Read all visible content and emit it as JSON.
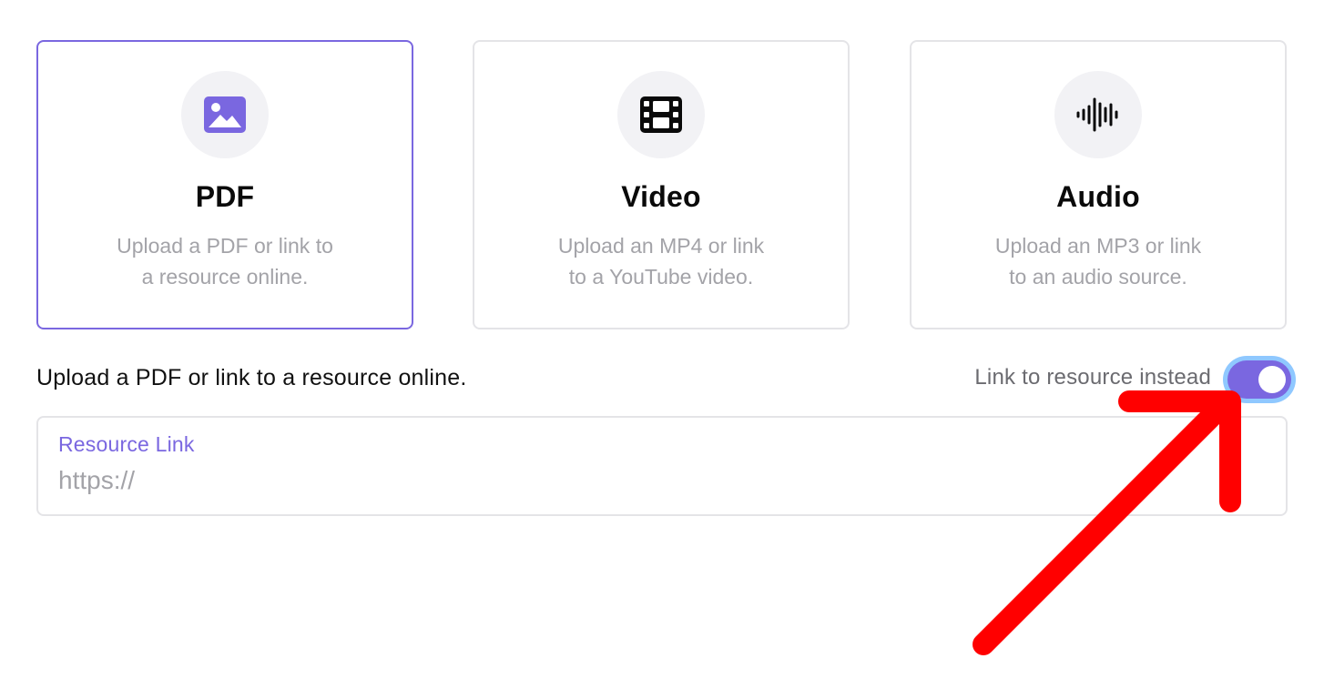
{
  "options": {
    "pdf": {
      "title": "PDF",
      "desc_line1": "Upload a PDF or link to",
      "desc_line2": "a resource online.",
      "icon": "image-icon",
      "selected": true
    },
    "video": {
      "title": "Video",
      "desc_line1": "Upload an MP4 or link",
      "desc_line2": "to a YouTube video.",
      "icon": "film-icon",
      "selected": false
    },
    "audio": {
      "title": "Audio",
      "desc_line1": "Upload an MP3 or link",
      "desc_line2": "to an audio source.",
      "icon": "audio-waveform-icon",
      "selected": false
    }
  },
  "upload": {
    "heading": "Upload a PDF or link to a resource online.",
    "toggle_label": "Link to resource instead",
    "toggle_on": true
  },
  "resource_link": {
    "label": "Resource Link",
    "placeholder": "https://",
    "value": ""
  },
  "colors": {
    "accent": "#7a67e0",
    "toggle_focus_ring": "#8fc8ff",
    "annotation_arrow": "#ff0000"
  }
}
